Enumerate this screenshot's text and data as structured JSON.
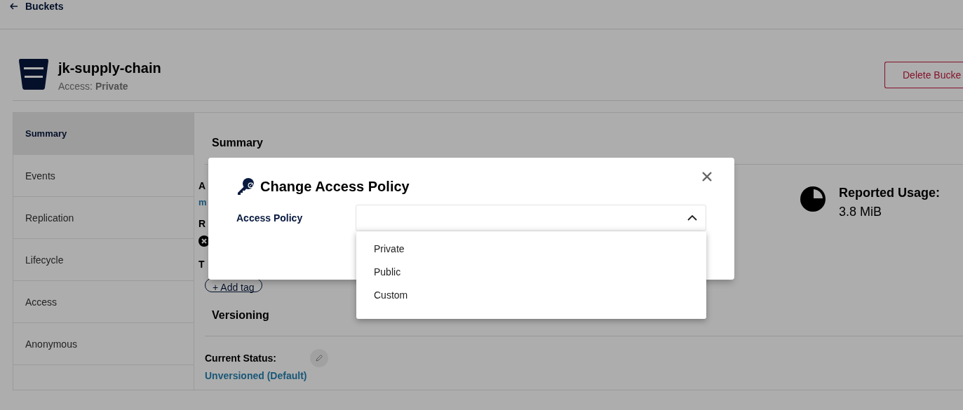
{
  "back_link": {
    "label": "Buckets"
  },
  "bucket": {
    "name": "jk-supply-chain",
    "access_label": "Access:",
    "access_value": "Private"
  },
  "delete_button": {
    "label": "Delete Bucke"
  },
  "sidebar": {
    "items": [
      {
        "label": "Summary",
        "selected": true
      },
      {
        "label": "Events",
        "selected": false
      },
      {
        "label": "Replication",
        "selected": false
      },
      {
        "label": "Lifecycle",
        "selected": false
      },
      {
        "label": "Access",
        "selected": false
      },
      {
        "label": "Anonymous",
        "selected": false
      }
    ]
  },
  "summary": {
    "title": "Summary",
    "partial_texts": [
      {
        "text": "A",
        "kind": "label"
      },
      {
        "text": "m",
        "kind": "link"
      },
      {
        "text": "R",
        "kind": "label"
      },
      {
        "text": "T",
        "kind": "label"
      }
    ],
    "add_tag": {
      "label": "+ Add tag"
    },
    "usage": {
      "label": "Reported Usage:",
      "value": "3.8 MiB"
    }
  },
  "versioning": {
    "title": "Versioning",
    "status_label": "Current Status:",
    "status_value": "Unversioned (Default)"
  },
  "modal": {
    "title": "Change Access Policy",
    "field_label": "Access Policy",
    "dropdown": {
      "expanded": true,
      "options": [
        {
          "label": "Private",
          "selected": false
        },
        {
          "label": "Public",
          "selected": false
        },
        {
          "label": "Custom",
          "selected": false
        }
      ]
    }
  }
}
